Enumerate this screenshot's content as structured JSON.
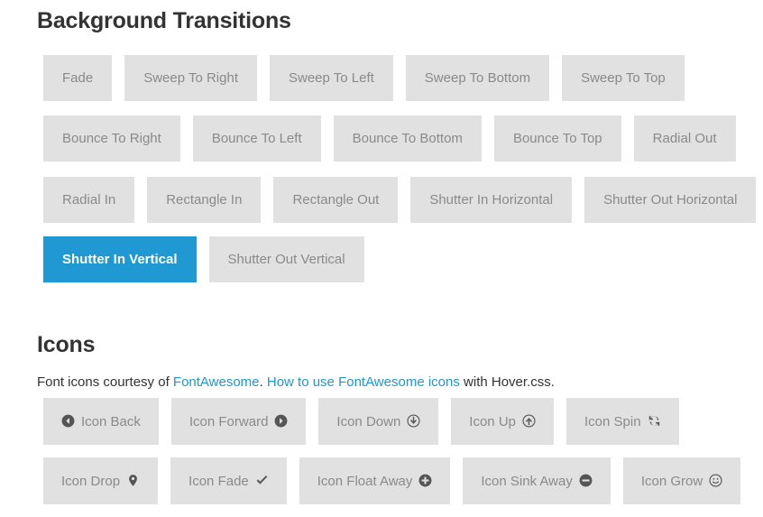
{
  "sections": {
    "background_transitions": {
      "heading": "Background Transitions",
      "rows": [
        [
          {
            "label": "Fade",
            "active": false
          },
          {
            "label": "Sweep To Right",
            "active": false
          },
          {
            "label": "Sweep To Left",
            "active": false
          },
          {
            "label": "Sweep To Bottom",
            "active": false
          },
          {
            "label": "Sweep To Top",
            "active": false
          }
        ],
        [
          {
            "label": "Bounce To Right",
            "active": false
          },
          {
            "label": "Bounce To Left",
            "active": false
          },
          {
            "label": "Bounce To Bottom",
            "active": false
          },
          {
            "label": "Bounce To Top",
            "active": false
          },
          {
            "label": "Radial Out",
            "active": false
          }
        ],
        [
          {
            "label": "Radial In",
            "active": false
          },
          {
            "label": "Rectangle In",
            "active": false
          },
          {
            "label": "Rectangle Out",
            "active": false
          },
          {
            "label": "Shutter In Horizontal",
            "active": false
          },
          {
            "label": "Shutter Out Horizontal",
            "active": false
          }
        ],
        [
          {
            "label": "Shutter In Vertical",
            "active": true
          },
          {
            "label": "Shutter Out Vertical",
            "active": false
          }
        ]
      ]
    },
    "icons": {
      "heading": "Icons",
      "lead": {
        "text_before": "Font icons courtesy of ",
        "link1": "FontAwesome",
        "text_middle": ". ",
        "link2": "How to use FontAwesome icons",
        "text_after": " with Hover.css."
      },
      "rows": [
        [
          {
            "label": "Icon Back",
            "icon": "arrow-circle-left-icon",
            "icon_position": "left"
          },
          {
            "label": "Icon Forward",
            "icon": "arrow-circle-right-icon",
            "icon_position": "right"
          },
          {
            "label": "Icon Down",
            "icon": "arrow-circle-o-down-icon",
            "icon_position": "right"
          },
          {
            "label": "Icon Up",
            "icon": "arrow-circle-o-up-icon",
            "icon_position": "right"
          },
          {
            "label": "Icon Spin",
            "icon": "refresh-icon",
            "icon_position": "right"
          }
        ],
        [
          {
            "label": "Icon Drop",
            "icon": "map-marker-icon",
            "icon_position": "right"
          },
          {
            "label": "Icon Fade",
            "icon": "check-icon",
            "icon_position": "right"
          },
          {
            "label": "Icon Float Away",
            "icon": "plus-circle-icon",
            "icon_position": "right"
          },
          {
            "label": "Icon Sink Away",
            "icon": "minus-circle-icon",
            "icon_position": "right"
          },
          {
            "label": "Icon Grow",
            "icon": "smile-o-icon",
            "icon_position": "right"
          }
        ]
      ]
    }
  },
  "colors": {
    "button_bg": "#e1e1e1",
    "button_text": "#8a8a8a",
    "active_bg": "#2098d1",
    "active_text": "#ffffff",
    "heading_text": "#333333",
    "link": "#2098d1"
  }
}
